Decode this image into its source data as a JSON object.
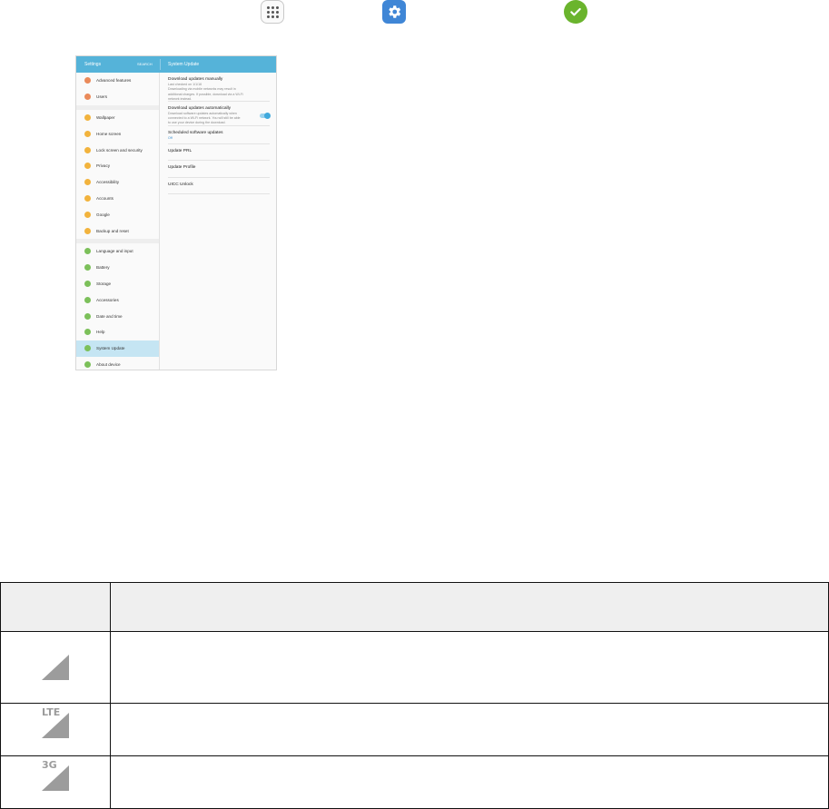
{
  "settings_screen": {
    "appbar": {
      "title": "Settings",
      "search": "SEARCH",
      "section": "System Update"
    },
    "menu_groups": [
      [
        {
          "label": "Advanced features",
          "color": "#ea8a5a"
        },
        {
          "label": "Users",
          "color": "#ea8a5a"
        }
      ],
      [
        {
          "label": "Wallpaper",
          "color": "#f2b33d"
        },
        {
          "label": "Home screen",
          "color": "#f2b33d"
        },
        {
          "label": "Lock screen and security",
          "color": "#f2b33d"
        },
        {
          "label": "Privacy",
          "color": "#f2b33d"
        },
        {
          "label": "Accessibility",
          "color": "#f2b33d"
        },
        {
          "label": "Accounts",
          "color": "#f2b33d"
        },
        {
          "label": "Google",
          "color": "#f2b33d"
        },
        {
          "label": "Backup and reset",
          "color": "#f2b33d"
        }
      ],
      [
        {
          "label": "Language and input",
          "color": "#7cc05a"
        },
        {
          "label": "Battery",
          "color": "#7cc05a"
        },
        {
          "label": "Storage",
          "color": "#7cc05a"
        },
        {
          "label": "Accessories",
          "color": "#7cc05a"
        },
        {
          "label": "Date and time",
          "color": "#7cc05a"
        },
        {
          "label": "Help",
          "color": "#7cc05a"
        },
        {
          "label": "System Update",
          "color": "#7cc05a",
          "active": true
        },
        {
          "label": "About device",
          "color": "#7cc05a"
        }
      ]
    ],
    "options": [
      {
        "title": "Download updates manually",
        "lines": [
          "Last checked on 1/1/16",
          "Downloading via mobile networks may result in",
          "additional charges. If possible, download via a Wi-Fi",
          "network instead."
        ]
      },
      {
        "title": "Download updates automatically",
        "lines": [
          "Download software updates automatically when",
          "connected to a Wi-Fi network. You will still be able",
          "to use your device during the download."
        ],
        "toggle": true
      },
      {
        "title": "Scheduled software updates",
        "lines": [
          "Off"
        ],
        "blue": true
      },
      {
        "title": "Update PRL",
        "lines": []
      },
      {
        "title": "Update Profile",
        "lines": []
      },
      {
        "title": "UICC Unlock",
        "lines": []
      }
    ]
  },
  "icons": [
    "apps-icon",
    "settings-gear-icon",
    "check-icon"
  ],
  "table": {
    "rows": [
      {
        "icon": "signal-icon",
        "label": ""
      },
      {
        "icon": "lte-signal-icon",
        "label": "LTE"
      },
      {
        "icon": "3g-signal-icon",
        "label": "3G"
      }
    ]
  }
}
